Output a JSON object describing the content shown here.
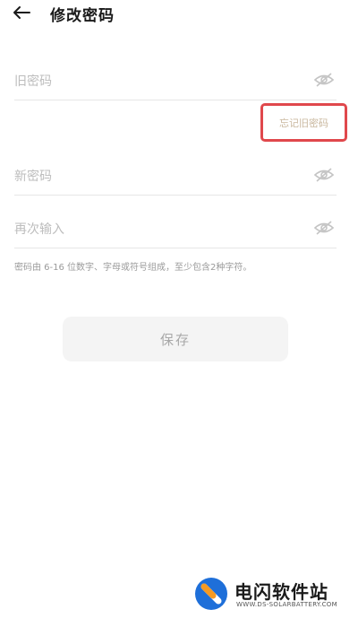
{
  "header": {
    "title": "修改密码",
    "back_icon": "arrow-left-icon"
  },
  "form": {
    "old_password": {
      "placeholder": "旧密码",
      "value": "",
      "icon": "eye-off-icon"
    },
    "forgot_link": "忘记旧密码",
    "new_password": {
      "placeholder": "新密码",
      "value": "",
      "icon": "eye-off-icon"
    },
    "confirm_password": {
      "placeholder": "再次输入",
      "value": "",
      "icon": "eye-off-icon"
    },
    "hint": "密码由 6-16 位数字、字母或符号组成，至少包含2种字符。"
  },
  "save_button": {
    "label": "保存"
  },
  "watermark": {
    "name": "电闪软件站",
    "url": "WWW.DS-SOLARBATTERY.COM"
  },
  "colors": {
    "highlight_border": "#e0484c",
    "link": "#c9b79e",
    "placeholder": "#bdbdbd",
    "button_bg": "#f4f4f4",
    "logo_blue": "#1e6fd9",
    "logo_orange": "#f59a23"
  }
}
